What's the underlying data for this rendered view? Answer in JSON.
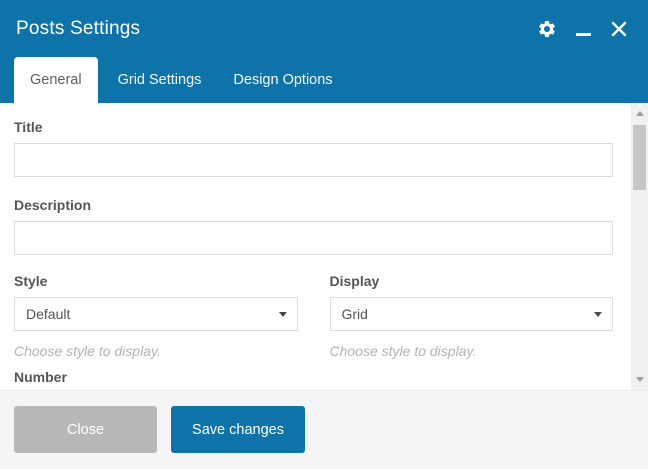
{
  "window": {
    "title": "Posts Settings",
    "icons": {
      "settings": "gear-icon",
      "minimize": "minimize-icon",
      "close": "close-icon"
    }
  },
  "tabs": [
    {
      "label": "General",
      "active": true
    },
    {
      "label": "Grid Settings",
      "active": false
    },
    {
      "label": "Design Options",
      "active": false
    }
  ],
  "form": {
    "title": {
      "label": "Title",
      "value": "",
      "placeholder": ""
    },
    "description": {
      "label": "Description",
      "value": "",
      "placeholder": ""
    },
    "style": {
      "label": "Style",
      "value": "Default",
      "help": "Choose style to display."
    },
    "display": {
      "label": "Display",
      "value": "Grid",
      "help": "Choose style to display."
    },
    "number": {
      "label": "Number"
    }
  },
  "footer": {
    "close_label": "Close",
    "save_label": "Save changes"
  },
  "scrollbar": {
    "up_icon": "scroll-up-arrow-icon",
    "down_icon": "scroll-down-arrow-icon"
  },
  "colors": {
    "accent": "#0e73a8",
    "titlebar_bg": "#0e73a8",
    "active_tab_bg": "#ffffff",
    "footer_bg": "#f5f5f5",
    "close_button_bg": "#b8b8b8",
    "save_button_bg": "#0e73a8",
    "label_text": "#555555",
    "helper_text": "#b3b3b3",
    "input_border": "#dddddd"
  }
}
